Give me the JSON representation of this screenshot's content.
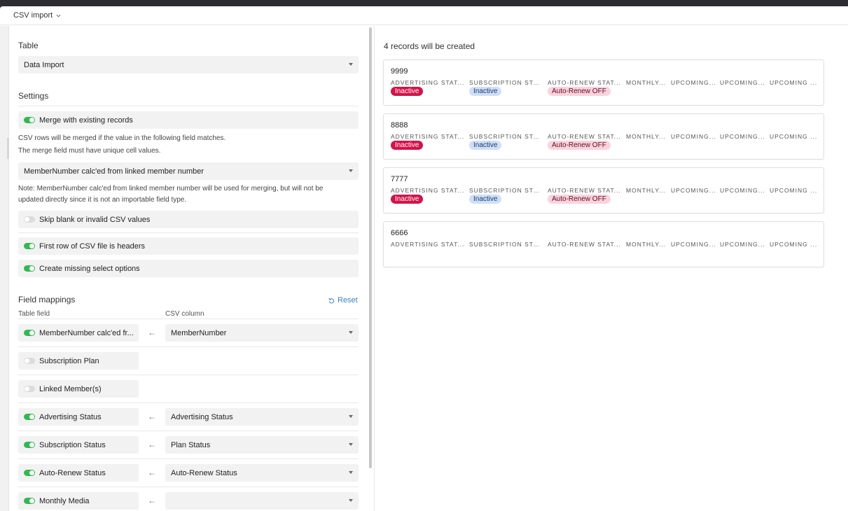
{
  "window": {
    "title": "CSV import"
  },
  "table_section": {
    "title": "Table",
    "selected": "Data Import"
  },
  "settings": {
    "title": "Settings",
    "merge_label": "Merge with existing records",
    "merge_note_1": "CSV rows will be merged if the value in the following field matches.",
    "merge_note_2": "The merge field must have unique cell values.",
    "merge_field": "MemberNumber calc'ed from linked member number",
    "field_note_1": "Note: MemberNumber calc'ed from linked member number will be used for merging, but will not be",
    "field_note_2": "updated directly since it is not an importable field type.",
    "skip_label": "Skip blank or invalid CSV values",
    "headers_label": "First row of CSV file is headers",
    "create_label": "Create missing select options"
  },
  "mappings": {
    "title": "Field mappings",
    "reset_label": "Reset",
    "table_field_header": "Table field",
    "csv_column_header": "CSV column",
    "arrow": "←",
    "rows": [
      {
        "field": "MemberNumber calc'ed fr...",
        "enabled": true,
        "column": "MemberNumber"
      },
      {
        "field": "Subscription Plan",
        "enabled": false,
        "column": null
      },
      {
        "field": "Linked Member(s)",
        "enabled": false,
        "column": null
      },
      {
        "field": "Advertising Status",
        "enabled": true,
        "column": "Advertising Status"
      },
      {
        "field": "Subscription Status",
        "enabled": true,
        "column": "Plan Status"
      },
      {
        "field": "Auto-Renew Status",
        "enabled": true,
        "column": "Auto-Renew Status"
      },
      {
        "field": "Monthly Media",
        "enabled": true,
        "column": ""
      }
    ]
  },
  "preview": {
    "title": "4 records will be created",
    "columns": [
      "ADVERTISING STAT...",
      "SUBSCRIPTION STA...",
      "AUTO-RENEW STAT...",
      "MONTHLY...",
      "UPCOMING...",
      "UPCOMING...",
      "UPCOMING ..."
    ],
    "column_header_variants": {
      "first": [
        "ADVERTISING STAT...",
        "SUBSCRIPTION STAT...",
        "AUTO-RENEW STAT...",
        "MONTHLY...",
        "UPCOMING...",
        "UPCOMING...",
        "UPCOMING ..."
      ]
    },
    "records": [
      {
        "id": "9999",
        "advertising": "Inactive",
        "subscription": "Inactive",
        "autorenew": "Auto-Renew OFF"
      },
      {
        "id": "8888",
        "advertising": "Inactive",
        "subscription": "Inactive",
        "autorenew": "Auto-Renew OFF"
      },
      {
        "id": "7777",
        "advertising": "Inactive",
        "subscription": "Inactive",
        "autorenew": "Auto-Renew OFF"
      },
      {
        "id": "6666",
        "advertising": null,
        "subscription": null,
        "autorenew": null
      }
    ]
  },
  "colors": {
    "toggle_on": "#2fba4f",
    "toggle_off": "#dcdcdc",
    "pill_red_bg": "#d6124a",
    "pill_red_text": "#ffffff",
    "pill_blue_bg": "#cfdff8",
    "pill_blue_text": "#1f3b66",
    "pill_pink_bg": "#fbd2dd",
    "pill_pink_text": "#5a1020",
    "link_blue": "#3b82c4"
  }
}
